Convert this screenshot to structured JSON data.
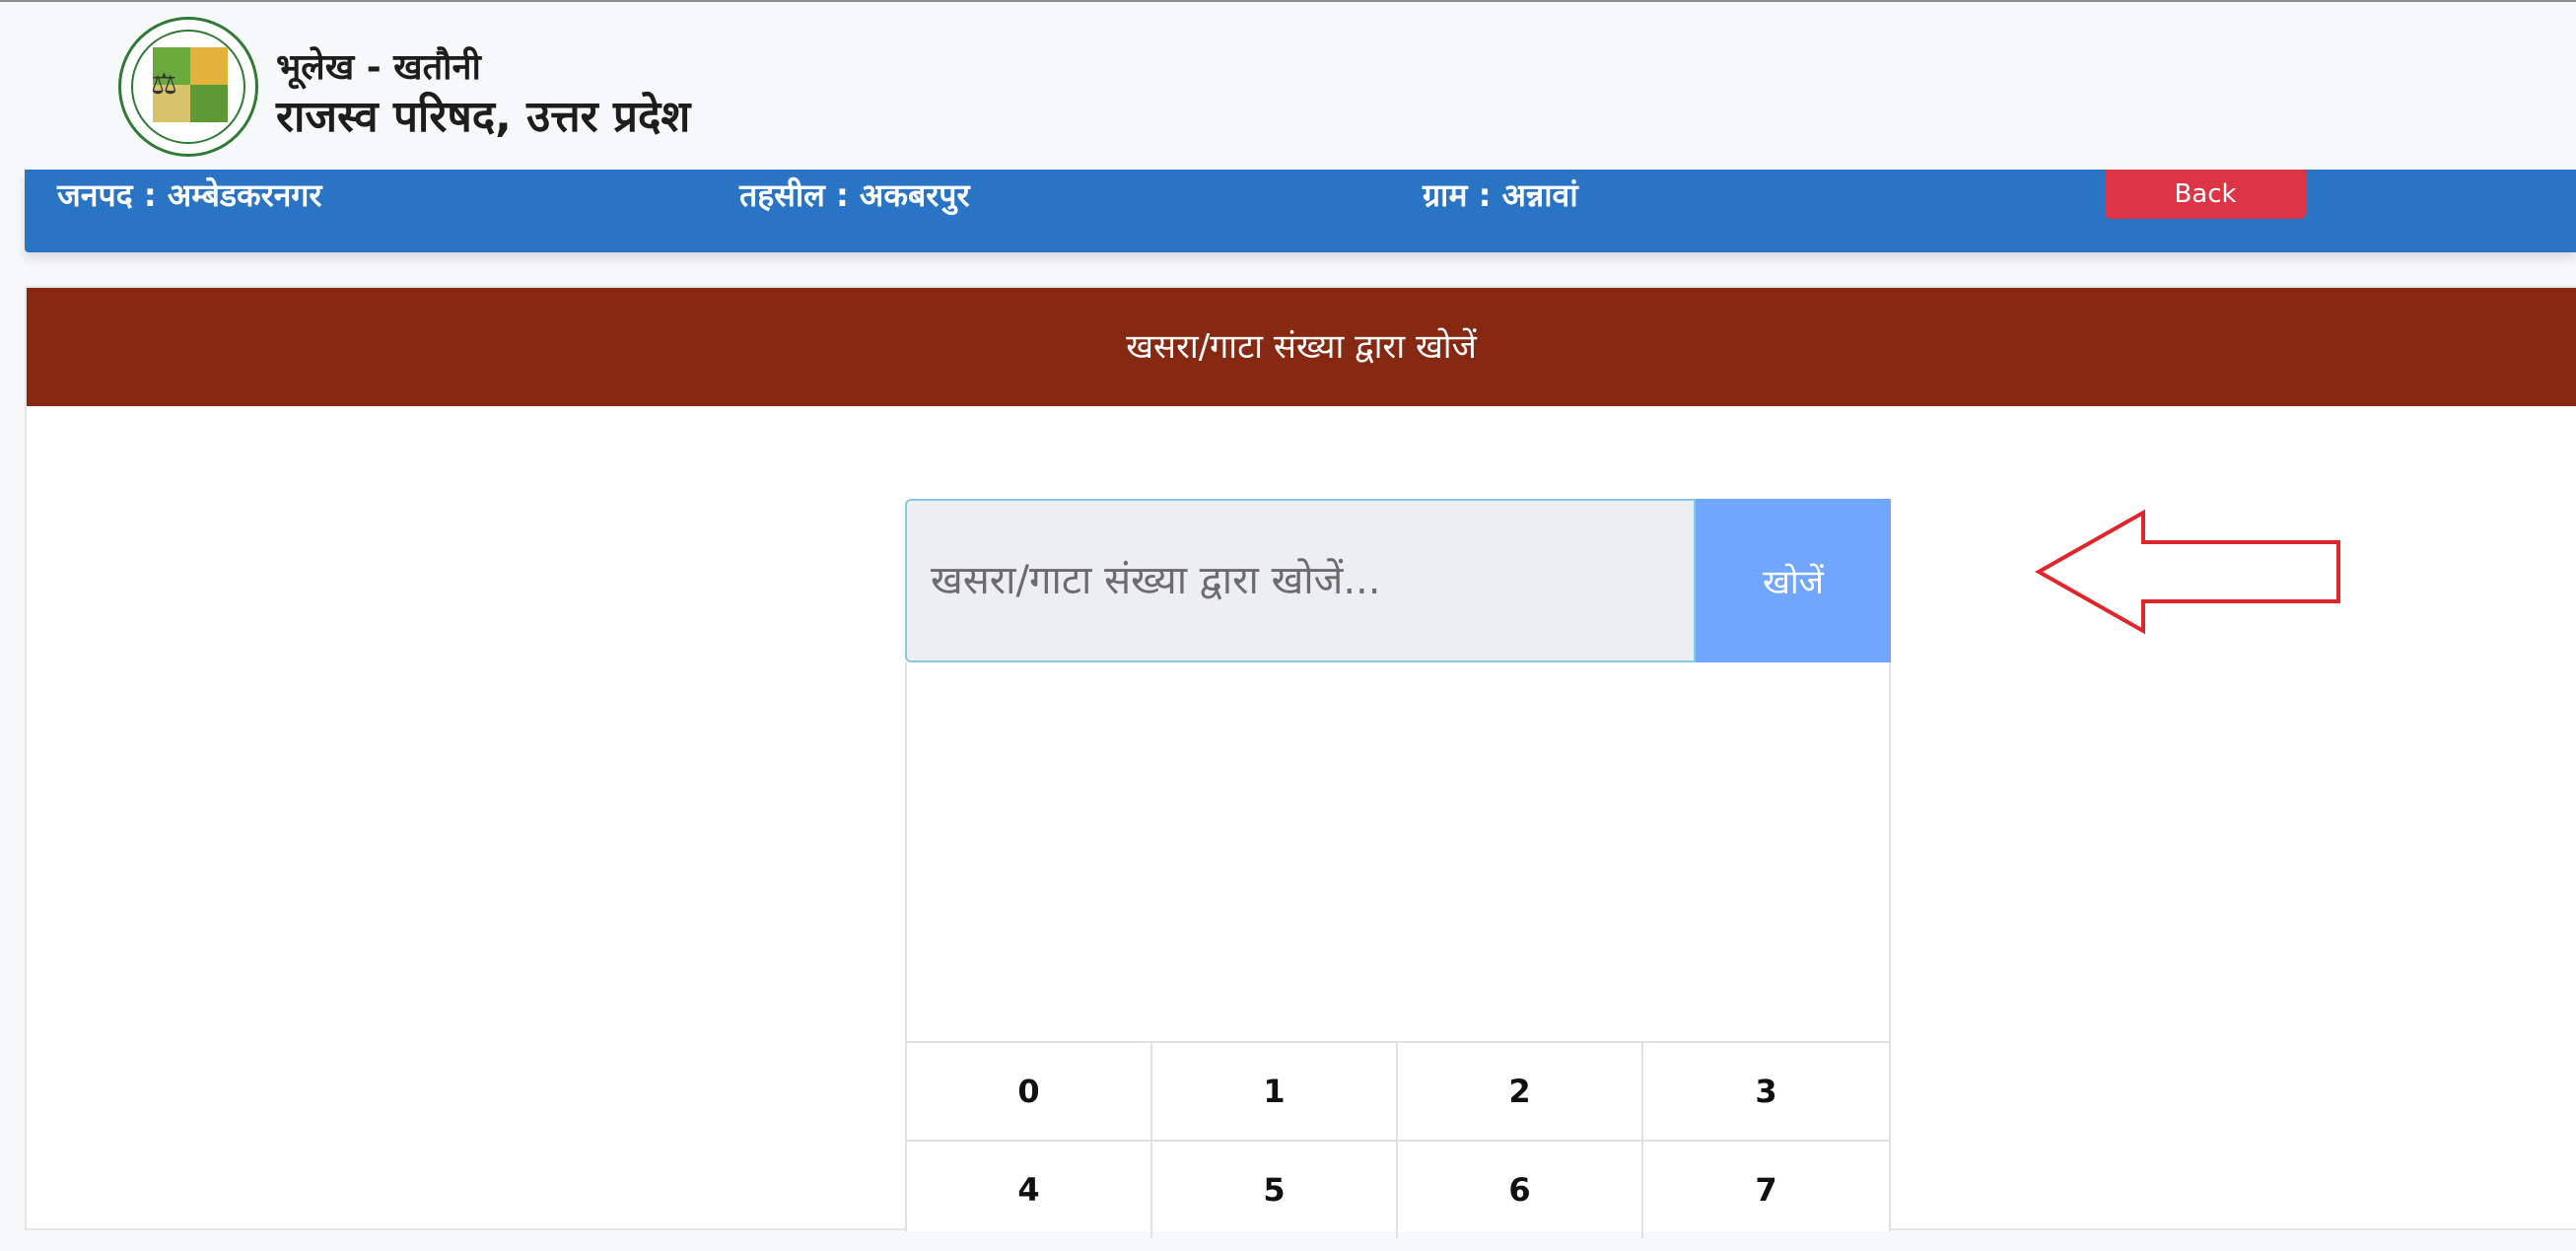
{
  "header": {
    "subtitle": "भूलेख - खतौनी",
    "title": "राजस्व परिषद, उत्तर प्रदेश"
  },
  "info_bar": {
    "district": "जनपद : अम्बेडकरनगर",
    "tehsil": "तहसील : अकबरपुर",
    "village": "ग्राम : अन्नावां",
    "back_label": "Back"
  },
  "search_card": {
    "heading": "खसरा/गाटा संख्या द्वारा खोजें",
    "placeholder": "खसरा/गाटा संख्या द्वारा खोजें...",
    "button_label": "खोजें"
  },
  "keypad": {
    "keys": [
      "0",
      "1",
      "2",
      "3",
      "4",
      "5",
      "6",
      "7"
    ]
  },
  "colors": {
    "info_bar": "#2a74c6",
    "card_header": "#862812",
    "back_button": "#dc3545",
    "search_button": "#71a6ff",
    "annotation_arrow": "#e0262c"
  }
}
